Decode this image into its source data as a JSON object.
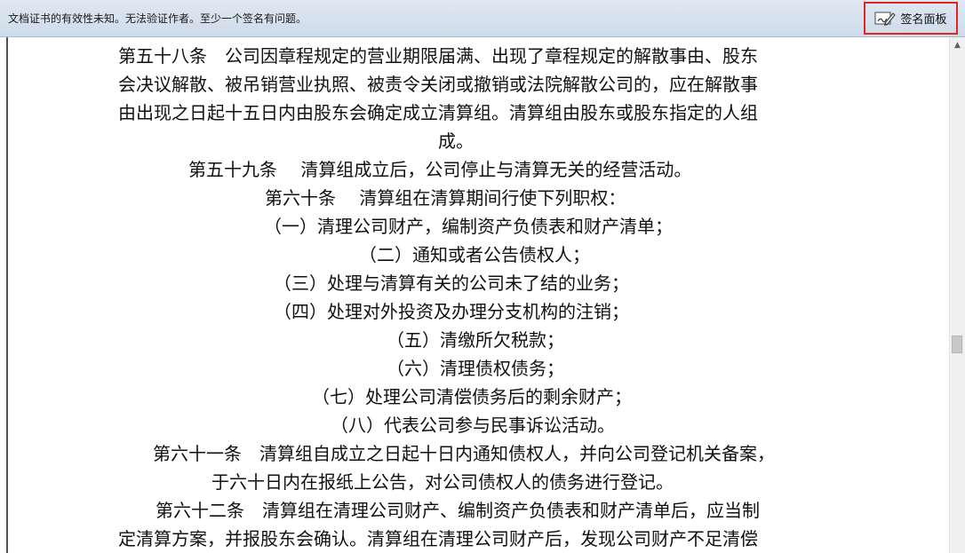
{
  "signature_bar": {
    "message": "文档证书的有效性未知。无法验证作者。至少一个签名有问题。",
    "panel_button_label": "签名面板",
    "panel_button_icon": "signature-pen-icon",
    "highlight_color": "#e0271f"
  },
  "document": {
    "lines": [
      "第五十八条　公司因章程规定的营业期限届满、出现了章程规定的解散事由、股东",
      "会决议解散、被吊销营业执照、被责令关闭或撤销或法院解散公司的，应在解散事",
      "由出现之日起十五日内由股东会确定成立清算组。清算组由股东或股东指定的人组",
      "成。",
      "第五十九条　 清算组成立后，公司停止与清算无关的经营活动。",
      "第六十条　 清算组在清算期间行使下列职权：",
      "（一）清理公司财产，编制资产负债表和财产清单；",
      "（二）通知或者公告债权人；",
      "（三）处理与清算有关的公司未了结的业务；",
      "（四）处理对外投资及办理分支机构的注销；",
      "（五）清缴所欠税款；",
      "（六）清理债权债务；",
      "（七）处理公司清偿债务后的剩余财产；",
      "（八）代表公司参与民事诉讼活动。",
      "第六十一条　清算组自成立之日起十日内通知债权人，并向公司登记机关备案，",
      "于六十日内在报纸上公告，对公司债权人的债务进行登记。",
      "第六十二条　清算组在清理公司财产、编制资产负债表和财产清单后，应当制",
      "定清算方案，并报股东会确认。清算组在清理公司财产后，发现公司财产不足清偿"
    ]
  },
  "scrollbar": {
    "up_arrow_icon": "scroll-up-arrow-icon"
  }
}
